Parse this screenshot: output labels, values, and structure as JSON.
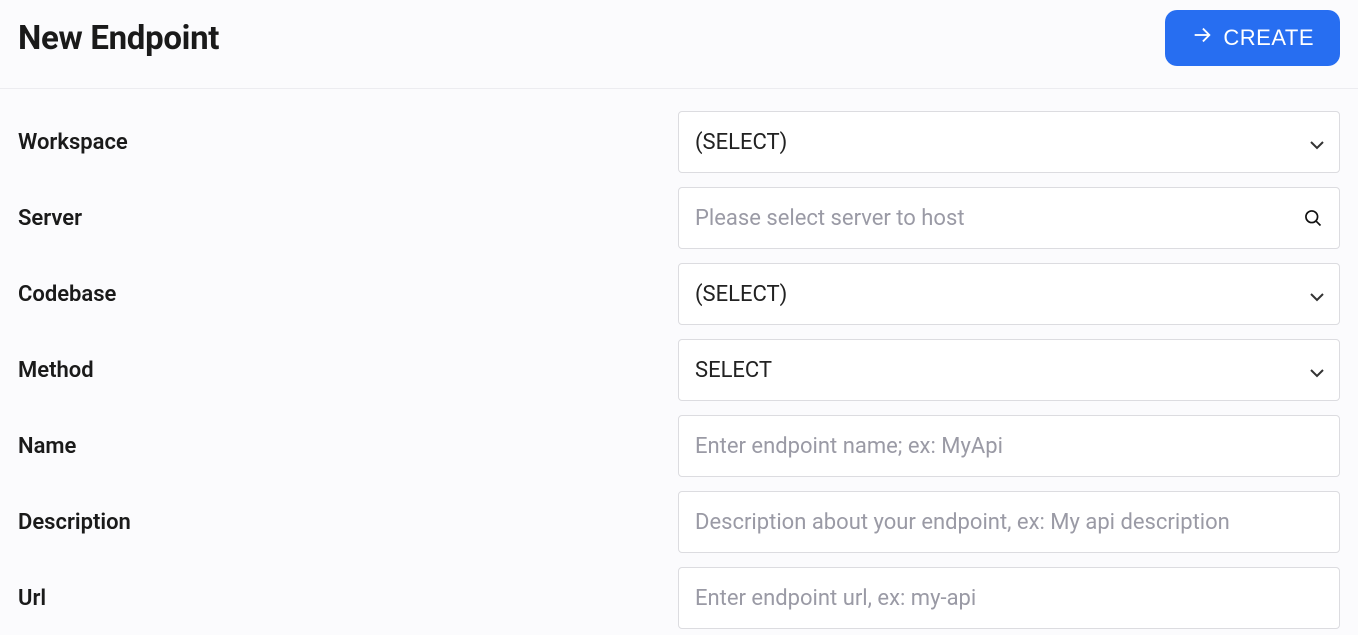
{
  "header": {
    "title": "New Endpoint",
    "create_label": "CREATE"
  },
  "form": {
    "workspace": {
      "label": "Workspace",
      "value": "(SELECT)"
    },
    "server": {
      "label": "Server",
      "placeholder": "Please select server to host"
    },
    "codebase": {
      "label": "Codebase",
      "value": "(SELECT)"
    },
    "method": {
      "label": "Method",
      "value": "SELECT"
    },
    "name": {
      "label": "Name",
      "placeholder": "Enter endpoint name; ex: MyApi"
    },
    "description": {
      "label": "Description",
      "placeholder": "Description about your endpoint, ex: My api description"
    },
    "url": {
      "label": "Url",
      "placeholder": "Enter endpoint url, ex: my-api"
    }
  }
}
